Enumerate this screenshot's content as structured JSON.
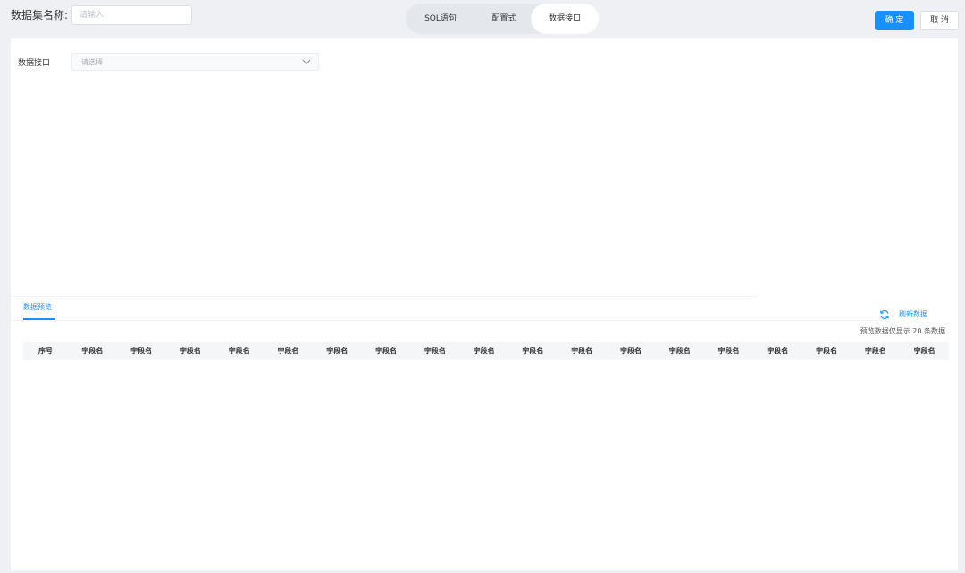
{
  "header": {
    "dataset_name_label": "数据集名称:",
    "dataset_name_placeholder": "请输入",
    "dataset_name_value": "",
    "mode_tabs": [
      {
        "label": "SQL语句",
        "active": false
      },
      {
        "label": "配置式",
        "active": false
      },
      {
        "label": "数据接口",
        "active": true
      }
    ],
    "confirm_label": "确 定",
    "cancel_label": "取 消"
  },
  "config": {
    "interface_label": "数据接口",
    "interface_placeholder": "请选择",
    "chevron_icon": "chevron-down-icon"
  },
  "preview": {
    "tab_label": "数据预览",
    "refresh_icon": "refresh-icon",
    "refresh_label": "刷新数据",
    "note": "预览数据仅显示 20 条数据",
    "columns": [
      "序号",
      "字段名",
      "字段名",
      "字段名",
      "字段名",
      "字段名",
      "字段名",
      "字段名",
      "字段名",
      "字段名",
      "字段名",
      "字段名",
      "字段名",
      "字段名",
      "字段名",
      "字段名",
      "字段名",
      "字段名",
      "字段名"
    ],
    "rows": []
  },
  "colors": {
    "accent": "#1890ff",
    "page_bg": "#eef0f3",
    "panel_bg": "#ffffff",
    "table_header_bg": "#f5f6f8"
  }
}
